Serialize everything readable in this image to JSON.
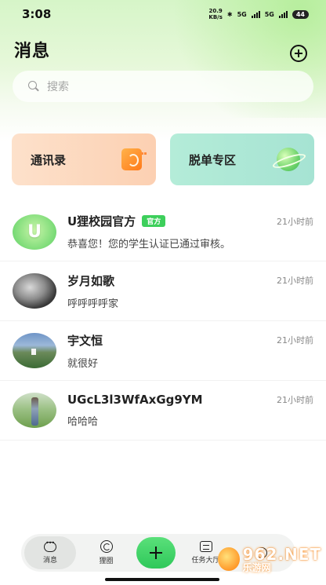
{
  "status_bar": {
    "time": "3:08",
    "net_speed_value": "20.9",
    "net_speed_unit": "KB/s",
    "bluetooth_icon": "bluetooth-icon",
    "signal1_label": "5G",
    "signal2_label": "5G",
    "battery": "44"
  },
  "header": {
    "title": "消息",
    "add_icon": "plus-circle-icon"
  },
  "search": {
    "placeholder": "搜索"
  },
  "quick_cards": [
    {
      "label": "通讯录",
      "icon": "contact-book-icon",
      "color": "#fcd6ba"
    },
    {
      "label": "脱单专区",
      "icon": "planet-icon",
      "color": "#aee8d6"
    }
  ],
  "conversations": [
    {
      "name": "U狸校园官方",
      "badge": "官方",
      "time": "21小时前",
      "preview": "恭喜您！您的学生认证已通过审核。"
    },
    {
      "name": "岁月如歌",
      "time": "21小时前",
      "preview": "呼呼呼呼家"
    },
    {
      "name": "宇文恒",
      "time": "21小时前",
      "preview": "就很好"
    },
    {
      "name": "UGcL3l3WfAxGg9YM",
      "time": "21小时前",
      "preview": "哈哈哈"
    }
  ],
  "avatar_letter": "U",
  "tabbar": {
    "tabs": [
      {
        "label": "消息",
        "icon": "chat-bubble-icon",
        "active": true
      },
      {
        "label": "狸圈",
        "icon": "circle-icon",
        "active": false
      },
      {
        "label": "",
        "icon": "plus-icon",
        "active": false
      },
      {
        "label": "任务大厅",
        "icon": "task-icon",
        "active": false
      },
      {
        "label": "",
        "icon": "profile-icon",
        "active": false
      }
    ]
  },
  "watermark": {
    "big": "962.NET",
    "small": "乐游网"
  },
  "colors": {
    "accent_green": "#3dcf5b",
    "badge_green": "#3dcf5b"
  }
}
